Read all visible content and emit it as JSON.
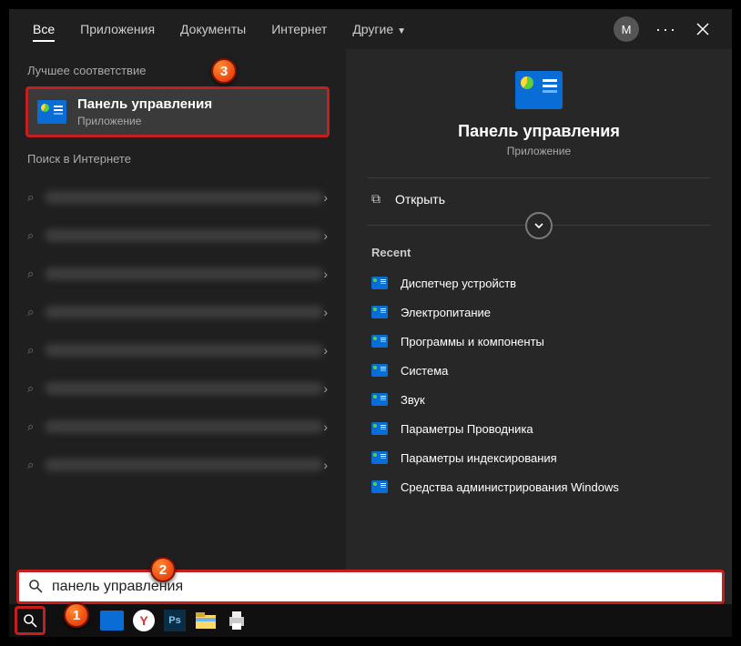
{
  "tabs": {
    "all": "Все",
    "apps": "Приложения",
    "docs": "Документы",
    "web": "Интернет",
    "more": "Другие"
  },
  "avatar": "М",
  "sections": {
    "best": "Лучшее соответствие",
    "web": "Поиск в Интернете",
    "recent": "Recent"
  },
  "bestMatch": {
    "title": "Панель управления",
    "subtitle": "Приложение"
  },
  "preview": {
    "title": "Панель управления",
    "subtitle": "Приложение",
    "open": "Открыть"
  },
  "recent": [
    {
      "label": "Диспетчер устройств"
    },
    {
      "label": "Электропитание"
    },
    {
      "label": "Программы и компоненты"
    },
    {
      "label": "Система"
    },
    {
      "label": "Звук"
    },
    {
      "label": "Параметры Проводника"
    },
    {
      "label": "Параметры индексирования"
    },
    {
      "label": "Средства администрирования Windows"
    }
  ],
  "search": {
    "query": "панель управления"
  },
  "badges": {
    "b1": "1",
    "b2": "2",
    "b3": "3"
  }
}
